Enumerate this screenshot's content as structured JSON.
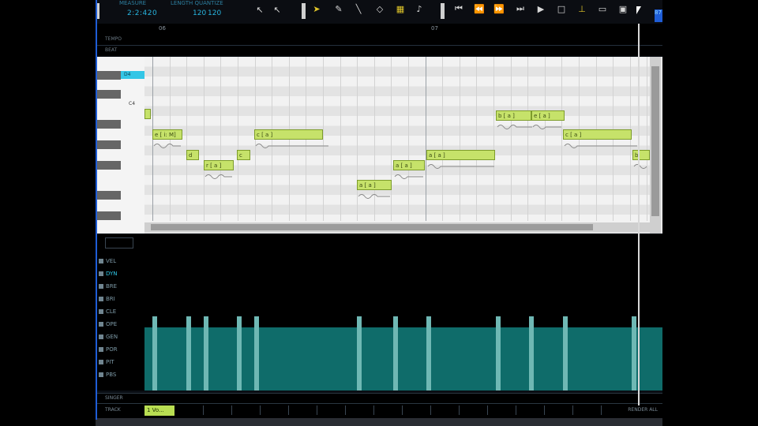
{
  "toolbar": {
    "mode_label": "MEASURE",
    "quantize_label": "LENGTH  QUANTIZE",
    "position": "2:2:420",
    "tempo": "120",
    "tempo_alt": "120",
    "corner": "87"
  },
  "ruler": {
    "bar_a": "06",
    "bar_b": "07"
  },
  "rows": {
    "tempo": "TEMPO",
    "beat": "BEAT",
    "singer": "SINGER",
    "track": "TRACK"
  },
  "roll": {
    "c4_label": "C4",
    "cursor_chip": "D4"
  },
  "notes": [
    {
      "label": "e [ i: M]"
    },
    {
      "label": "d"
    },
    {
      "label": "r [ a ]"
    },
    {
      "label": "c"
    },
    {
      "label": "c [ a ]"
    },
    {
      "label": "a [ a ]"
    },
    {
      "label": "a [ a ]"
    },
    {
      "label": "a [ a ]"
    },
    {
      "label": "b [ a ]"
    },
    {
      "label": "e [ a ]"
    },
    {
      "label": "c [ a ]"
    },
    {
      "label": "b"
    }
  ],
  "controls": [
    {
      "label": "VEL"
    },
    {
      "label": "DYN"
    },
    {
      "label": "BRE"
    },
    {
      "label": "BRI"
    },
    {
      "label": "CLE"
    },
    {
      "label": "OPE"
    },
    {
      "label": "GEN"
    },
    {
      "label": "POR"
    },
    {
      "label": "PIT"
    },
    {
      "label": "PBS"
    }
  ],
  "track": {
    "name": "1 Vo...",
    "render_all": "RENDER ALL"
  },
  "colors": {
    "note": "#c6e26a",
    "teal": "#0f6c6a",
    "accent": "#27b5e0",
    "frame": "#1f5dd6"
  }
}
